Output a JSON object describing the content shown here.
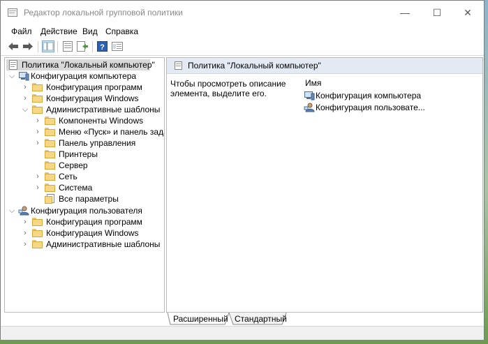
{
  "window": {
    "title": "Редактор локальной групповой политики",
    "minimize": "—",
    "maximize": "☐",
    "close": "✕"
  },
  "menu": [
    "Файл",
    "Действие",
    "Вид",
    "Справка"
  ],
  "toolbar": {
    "icons": [
      "back-icon",
      "forward-icon",
      "show-tree-icon",
      "properties-icon",
      "export-list-icon",
      "help-icon",
      "console-view-icon"
    ]
  },
  "tree": {
    "root": "Политика \"Локальный компьютер\"",
    "computer": "Конфигурация компьютера",
    "computer_items": {
      "programs": "Конфигурация программ",
      "windows": "Конфигурация Windows",
      "admin": "Административные шаблоны"
    },
    "admin_items": [
      "Компоненты Windows",
      "Меню «Пуск» и панель задач",
      "Панель управления",
      "Принтеры",
      "Сервер",
      "Сеть",
      "Система",
      "Все параметры"
    ],
    "user": "Конфигурация пользователя",
    "user_items": {
      "programs": "Конфигурация программ",
      "windows": "Конфигурация Windows",
      "admin": "Административные шаблоны"
    }
  },
  "right": {
    "header": "Политика \"Локальный компьютер\"",
    "description": "Чтобы просмотреть описание элемента, выделите его.",
    "column_name": "Имя",
    "items": [
      "Конфигурация компьютера",
      "Конфигурация пользовате..."
    ]
  },
  "tabs": [
    "Расширенный",
    "Стандартный"
  ]
}
